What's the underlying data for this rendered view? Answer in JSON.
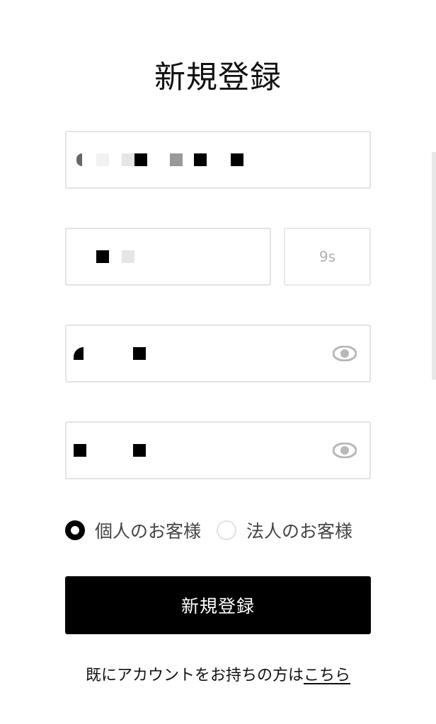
{
  "header": {
    "title": "新規登録"
  },
  "form": {
    "code_button_label": "9s",
    "account_type_options": [
      {
        "label": "個人のお客様",
        "selected": true
      },
      {
        "label": "法人のお客様",
        "selected": false
      }
    ],
    "submit_label": "新規登録",
    "login_prompt": "既にアカウントをお持ちの方は",
    "login_link_label": "こちら"
  },
  "colors": {
    "text": "#111111",
    "border": "#e3e3e3",
    "primary": "#000000",
    "muted": "#b0b0b0"
  }
}
